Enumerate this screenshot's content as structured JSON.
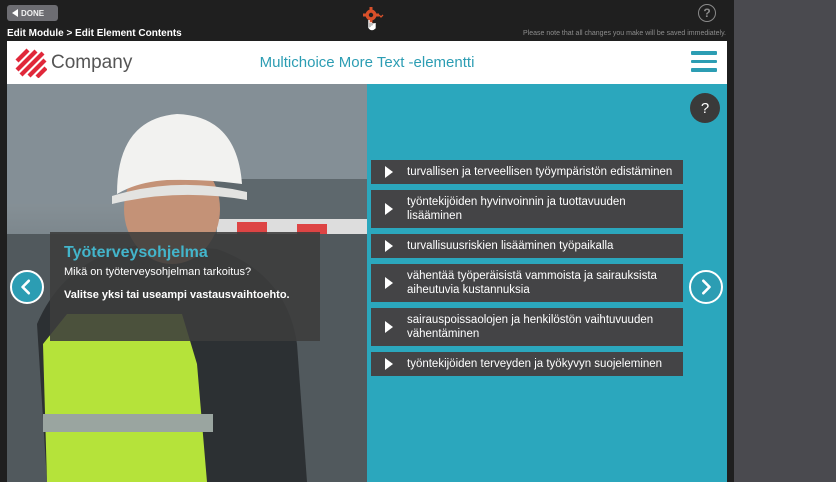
{
  "editor": {
    "done_label": "DONE",
    "breadcrumb": "Edit Module > Edit Element Contents",
    "save_note": "Please note that all changes you make will be saved immediately.",
    "help_glyph": "?"
  },
  "course": {
    "company_name": "Company",
    "element_title": "Multichoice More Text -elementti",
    "help_glyph": "?"
  },
  "question": {
    "title": "Työterveysohjelma",
    "text": "Mikä on työterveysohjelman tarkoitus?",
    "instruction": "Valitse yksi tai useampi vastausvaihtoehto."
  },
  "options": [
    {
      "label": "turvallisen ja terveellisen työympäristön edistäminen"
    },
    {
      "label": "työntekijöiden hyvinvoinnin ja tuottavuuden lisääminen"
    },
    {
      "label": "turvallisuusriskien lisääminen työpaikalla"
    },
    {
      "label": "vähentää työperäisistä vammoista ja sairauksista aiheutuvia kustannuksia"
    },
    {
      "label": "sairauspoissaolojen ja henkilöstön vaihtuvuuden vähentäminen"
    },
    {
      "label": "työntekijöiden terveyden ja työkyvyn suojeleminen"
    }
  ],
  "icons": {
    "settings": "gear-icon",
    "menu": "hamburger-menu-icon",
    "prev": "chevron-left-icon",
    "next": "chevron-right-icon",
    "option": "play-triangle-icon"
  },
  "colors": {
    "accent": "#2c9db3",
    "panel": "#2ba7bd",
    "option_bg": "#444446",
    "logo": "#e0283a"
  }
}
